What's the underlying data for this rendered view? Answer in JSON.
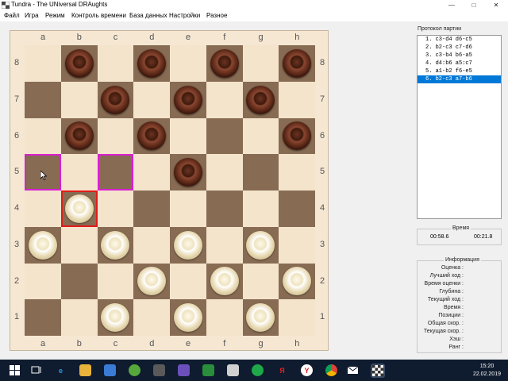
{
  "window": {
    "title": "Tundra - The UNiversal DRAughts",
    "controls": {
      "minimize": "—",
      "maximize": "□",
      "close": "✕"
    }
  },
  "menu": [
    "Файл",
    "Игра",
    "Режим",
    "Контроль времени",
    "База данных",
    "Настройки",
    "Разное"
  ],
  "board": {
    "files": [
      "a",
      "b",
      "c",
      "d",
      "e",
      "f",
      "g",
      "h"
    ],
    "ranks": [
      "8",
      "7",
      "6",
      "5",
      "4",
      "3",
      "2",
      "1"
    ],
    "pieces": {
      "black": [
        "b8",
        "d8",
        "f8",
        "h8",
        "c7",
        "e7",
        "g7",
        "b6",
        "d6",
        "h6",
        "e5"
      ],
      "white": [
        "b4",
        "a3",
        "c3",
        "e3",
        "g3",
        "d2",
        "f2",
        "h2",
        "c1",
        "e1",
        "g1"
      ]
    },
    "highlight_pink": [
      "a5",
      "c5"
    ],
    "highlight_red": [
      "b4"
    ]
  },
  "protocol": {
    "title": "Протокол партии",
    "moves": [
      "1. c3-d4 d6-c5",
      "2. b2-c3 c7-d6",
      "3. c3-b4 b6-a5",
      "4. d4:b6 a5:c7",
      "5. a1-b2 f6-e5",
      "6. b2-c3 a7-b6"
    ],
    "selected_index": 5
  },
  "time": {
    "title": "Время",
    "left": "00:58.6",
    "right": "00:21.8"
  },
  "info": {
    "title": "Информация",
    "rows": [
      "Оценка :",
      "Лучший ход :",
      "Время оценки :",
      "Глубина :",
      "Текущий ход :",
      "Время :",
      "Позиции :",
      "Общая скор. :",
      "Текущая скор. :",
      "Хэш :",
      "Ранг :"
    ]
  },
  "taskbar": {
    "time": "15:20",
    "date": "22.02.2019"
  }
}
